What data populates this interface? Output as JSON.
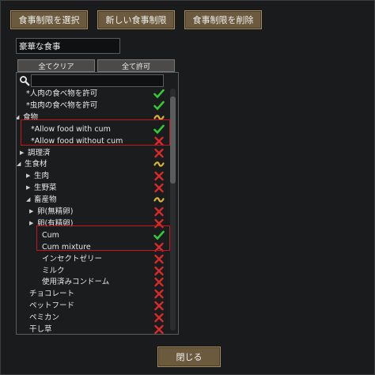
{
  "toolbar": {
    "select_label": "食事制限を選択",
    "new_label": "新しい食事制限",
    "delete_label": "食事制限を削除"
  },
  "policy_name": "豪華な食事",
  "buttons": {
    "clear_all": "全てクリア",
    "allow_all": "全て許可",
    "close": "閉じる"
  },
  "status_colors": {
    "allowed": "#36c936",
    "disallowed": "#d62b2b",
    "partial": "#d9b238",
    "highlight": "#c8161c"
  },
  "tree": [
    {
      "label": "*人肉の食べ物を許可",
      "status": "allowed",
      "expand": "none"
    },
    {
      "label": "*虫肉の食べ物を許可",
      "status": "allowed",
      "expand": "none"
    },
    {
      "label": "食物",
      "status": "partial",
      "expand": "expanded"
    },
    {
      "label": "*Allow food with cum",
      "status": "allowed",
      "expand": "none"
    },
    {
      "label": "*Allow food without cum",
      "status": "disallowed",
      "expand": "none"
    },
    {
      "label": "調理済",
      "status": "disallowed",
      "expand": "collapsed"
    },
    {
      "label": "生食材",
      "status": "partial",
      "expand": "expanded"
    },
    {
      "label": "生肉",
      "status": "disallowed",
      "expand": "collapsed"
    },
    {
      "label": "生野菜",
      "status": "disallowed",
      "expand": "collapsed"
    },
    {
      "label": "畜産物",
      "status": "partial",
      "expand": "expanded"
    },
    {
      "label": "卵(無精卵)",
      "status": "disallowed",
      "expand": "collapsed"
    },
    {
      "label": "卵(有精卵)",
      "status": "disallowed",
      "expand": "collapsed"
    },
    {
      "label": "Cum",
      "status": "allowed",
      "expand": "none"
    },
    {
      "label": "Cum mixture",
      "status": "disallowed",
      "expand": "none"
    },
    {
      "label": "インセクトゼリー",
      "status": "disallowed",
      "expand": "none"
    },
    {
      "label": "ミルク",
      "status": "disallowed",
      "expand": "none"
    },
    {
      "label": "使用済みコンドーム",
      "status": "disallowed",
      "expand": "none"
    },
    {
      "label": "チョコレート",
      "status": "disallowed",
      "expand": "none"
    },
    {
      "label": "ペットフード",
      "status": "disallowed",
      "expand": "none"
    },
    {
      "label": "ペミカン",
      "status": "disallowed",
      "expand": "none"
    },
    {
      "label": "干し草",
      "status": "disallowed",
      "expand": "none"
    }
  ]
}
